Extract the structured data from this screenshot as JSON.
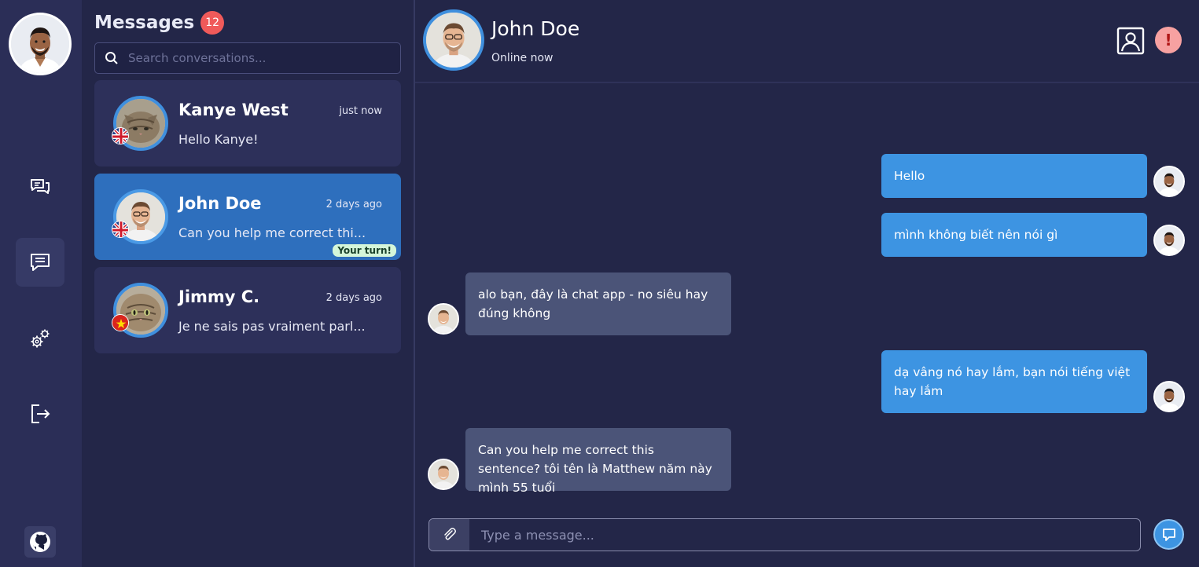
{
  "nav": {
    "user_avatar": "user-avatar",
    "items": [
      "conversations-icon",
      "messages-icon",
      "settings-icon",
      "logout-icon"
    ],
    "github_icon": "github-icon"
  },
  "conversations": {
    "title": "Messages",
    "unread_count": "12",
    "search_placeholder": "Search conversations...",
    "items": [
      {
        "name": "Kanye West",
        "time": "just now",
        "preview": "Hello Kanye!",
        "flag": "uk-flag",
        "active": false
      },
      {
        "name": "John Doe",
        "time": "2 days ago",
        "preview": "Can you help me correct thi...",
        "flag": "uk-flag",
        "active": true,
        "badge": "Your turn!"
      },
      {
        "name": "Jimmy C.",
        "time": "2 days ago",
        "preview": "Je ne sais pas vraiment parl...",
        "flag": "vn-flag",
        "active": false
      }
    ]
  },
  "chat": {
    "contact_name": "John Doe",
    "status": "Online now",
    "messages": [
      {
        "direction": "out",
        "text": "Hello"
      },
      {
        "direction": "out",
        "text": "mình không biết nên nói gì"
      },
      {
        "direction": "in",
        "text": "alo bạn, đây là chat app - no siêu hay đúng không"
      },
      {
        "direction": "out",
        "text": "dạ vâng nó hay lắm, bạn nói tiếng việt hay lắm"
      },
      {
        "direction": "in",
        "text": "Can you help me correct this sentence? tôi tên là Matthew năm này mình 55 tuổi"
      }
    ],
    "composer_placeholder": "Type a message...",
    "alert_symbol": "!"
  },
  "colors": {
    "background": "#232648",
    "sidebar": "#2b2e57",
    "accent": "#3d94e2",
    "active_item": "#2e6fbd",
    "incoming_bubble": "#4b5478",
    "badge": "#f05a5a"
  }
}
